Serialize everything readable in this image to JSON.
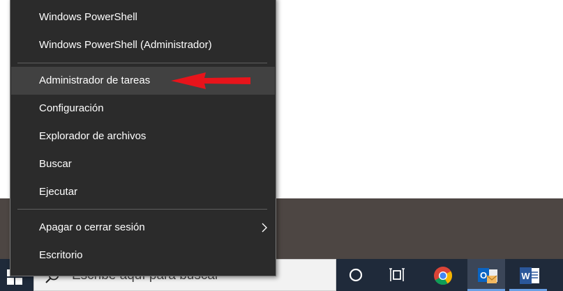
{
  "menu": {
    "items": [
      {
        "id": "powershell",
        "label": "Windows PowerShell"
      },
      {
        "id": "powershell-admin",
        "label": "Windows PowerShell (Administrador)"
      },
      {
        "id": "task-manager",
        "label": "Administrador de tareas"
      },
      {
        "id": "settings",
        "label": "Configuración"
      },
      {
        "id": "file-explorer",
        "label": "Explorador de archivos"
      },
      {
        "id": "search",
        "label": "Buscar"
      },
      {
        "id": "run",
        "label": "Ejecutar"
      },
      {
        "id": "shutdown",
        "label": "Apagar o cerrar sesión"
      },
      {
        "id": "desktop",
        "label": "Escritorio"
      }
    ],
    "highlighted_item": "Administrador de tareas",
    "has_submenu": "Apagar o cerrar sesión"
  },
  "taskbar": {
    "search_placeholder": "Escribe aquí para buscar",
    "icons": [
      "windows-logo-icon",
      "search-icon",
      "cortana-icon",
      "task-view-icon",
      "chrome-icon",
      "outlook-icon",
      "word-icon"
    ]
  },
  "annotation": {
    "arrow_color": "#e8141b",
    "points_to": "Administrador de tareas"
  },
  "colors": {
    "menu_bg": "#2b2b2b",
    "menu_highlight": "#414141",
    "taskbar_bg": "#1f2a3a",
    "desktop_band": "#4d4643"
  }
}
